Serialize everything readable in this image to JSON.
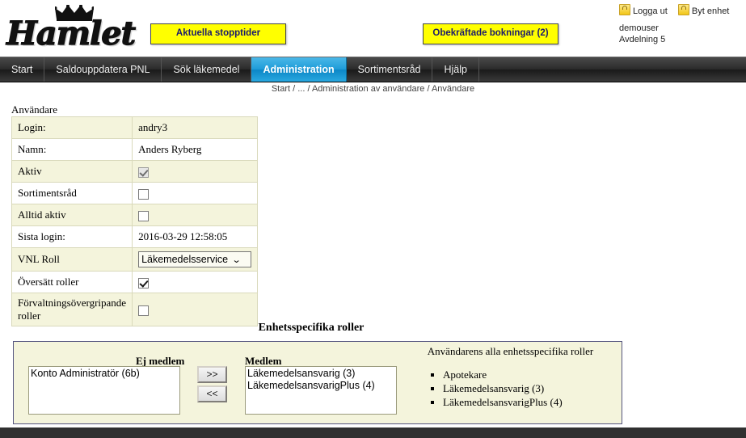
{
  "header": {
    "logo_text": "Hamlet",
    "logo_icon": "crown-icon",
    "stopptider_button": "Aktuella stopptider",
    "bokningar_button": "Obekräftade bokningar (2)",
    "logout_link": "Logga ut",
    "switch_unit_link": "Byt enhet",
    "username": "demouser",
    "unit": "Avdelning 5"
  },
  "nav": {
    "items": [
      {
        "label": "Start",
        "active": false
      },
      {
        "label": "Saldouppdatera PNL",
        "active": false
      },
      {
        "label": "Sök läkemedel",
        "active": false
      },
      {
        "label": "Administration",
        "active": true
      },
      {
        "label": "Sortimentsråd",
        "active": false
      },
      {
        "label": "Hjälp",
        "active": false
      }
    ]
  },
  "breadcrumb": "Start / ... / Administration av användare / Användare",
  "user_section": {
    "title": "Användare",
    "rows": [
      {
        "label": "Login:",
        "type": "text",
        "value": "andry3"
      },
      {
        "label": "Namn:",
        "type": "text",
        "value": "Anders Ryberg"
      },
      {
        "label": "Aktiv",
        "type": "checkbox",
        "checked": true,
        "disabled": true
      },
      {
        "label": "Sortimentsråd",
        "type": "checkbox",
        "checked": false,
        "disabled": false
      },
      {
        "label": "Alltid aktiv",
        "type": "checkbox",
        "checked": false,
        "disabled": false
      },
      {
        "label": "Sista login:",
        "type": "text",
        "value": "2016-03-29 12:58:05"
      },
      {
        "label": "VNL Roll",
        "type": "select",
        "value": "Läkemedelsservice"
      },
      {
        "label": "Översätt roller",
        "type": "checkbox",
        "checked": true,
        "disabled": false
      },
      {
        "label": "Förvaltningsövergripande roller",
        "type": "checkbox",
        "checked": false,
        "disabled": false
      }
    ]
  },
  "roles": {
    "heading": "Enhetsspecifika roller",
    "non_member_label": "Ej medlem",
    "member_label": "Medlem",
    "all_roles_label": "Användarens alla enhetsspecifika roller",
    "non_member_options": [
      "Konto Administratör (6b)"
    ],
    "member_options": [
      "Läkemedelsansvarig (3)",
      "LäkemedelsansvarigPlus (4)"
    ],
    "add_button": ">>",
    "remove_button": "<<",
    "all_roles": [
      "Apotekare",
      "Läkemedelsansvarig (3)",
      "LäkemedelsansvarigPlus (4)"
    ]
  }
}
